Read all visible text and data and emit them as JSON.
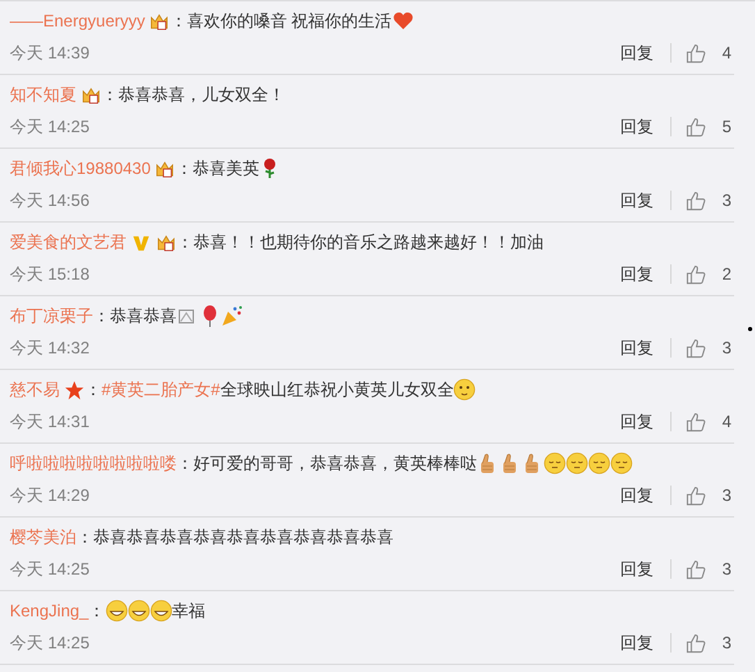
{
  "comments": [
    {
      "user": "——Energyueryyy",
      "badges": [
        {
          "kind": "crown"
        }
      ],
      "parts": [
        {
          "kind": "text",
          "text": "喜欢你的嗓音 祝福你的生活"
        },
        {
          "kind": "heart"
        }
      ],
      "time": "今天 14:39",
      "reply": "回复",
      "likes": "4"
    },
    {
      "user": "知不知夏",
      "badges": [
        {
          "kind": "crown"
        }
      ],
      "parts": [
        {
          "kind": "text",
          "text": "恭喜恭喜，儿女双全！"
        }
      ],
      "time": "今天 14:25",
      "reply": "回复",
      "likes": "5"
    },
    {
      "user": "君倾我心19880430",
      "badges": [
        {
          "kind": "crown"
        }
      ],
      "parts": [
        {
          "kind": "text",
          "text": "恭喜美英"
        },
        {
          "kind": "rose"
        }
      ],
      "time": "今天 14:56",
      "reply": "回复",
      "likes": "3"
    },
    {
      "user": "爱美食的文艺君",
      "badges": [
        {
          "kind": "v"
        },
        {
          "kind": "crown"
        }
      ],
      "parts": [
        {
          "kind": "text",
          "text": "恭喜！！也期待你的音乐之路越来越好！！加油"
        }
      ],
      "time": "今天 15:18",
      "reply": "回复",
      "likes": "2"
    },
    {
      "user": "布丁凉栗子",
      "parts": [
        {
          "kind": "text",
          "text": "恭喜恭喜"
        },
        {
          "kind": "broken"
        },
        {
          "kind": "balloon"
        },
        {
          "kind": "party"
        }
      ],
      "time": "今天 14:32",
      "reply": "回复",
      "likes": "3"
    },
    {
      "user": "慈不易",
      "badges": [
        {
          "kind": "star"
        }
      ],
      "parts": [
        {
          "kind": "topic",
          "text": "#黄英二胎产女#"
        },
        {
          "kind": "text",
          "text": " 全球映山红恭祝小黄英儿女双全"
        },
        {
          "kind": "blush"
        }
      ],
      "time": "今天 14:31",
      "reply": "回复",
      "likes": "4"
    },
    {
      "user": "呼啦啦啦啦啦啦啦啦喽",
      "parts": [
        {
          "kind": "text",
          "text": "好可爱的哥哥，恭喜恭喜，黄英棒棒哒"
        },
        {
          "kind": "thumb"
        },
        {
          "kind": "thumb"
        },
        {
          "kind": "thumb"
        },
        {
          "kind": "calm"
        },
        {
          "kind": "calm"
        },
        {
          "kind": "calm"
        },
        {
          "kind": "calm"
        }
      ],
      "time": "今天 14:29",
      "reply": "回复",
      "likes": "3"
    },
    {
      "user": "樱芩美泊",
      "parts": [
        {
          "kind": "text",
          "text": "恭喜恭喜恭喜恭喜恭喜恭喜恭喜恭喜恭喜"
        }
      ],
      "time": "今天 14:25",
      "reply": "回复",
      "likes": "3"
    },
    {
      "user": "KengJing_",
      "parts": [
        {
          "kind": "grin"
        },
        {
          "kind": "grin"
        },
        {
          "kind": "grin"
        },
        {
          "kind": "text",
          "text": "幸福"
        }
      ],
      "time": "今天 14:25",
      "reply": "回复",
      "likes": "3"
    }
  ],
  "colon": "："
}
